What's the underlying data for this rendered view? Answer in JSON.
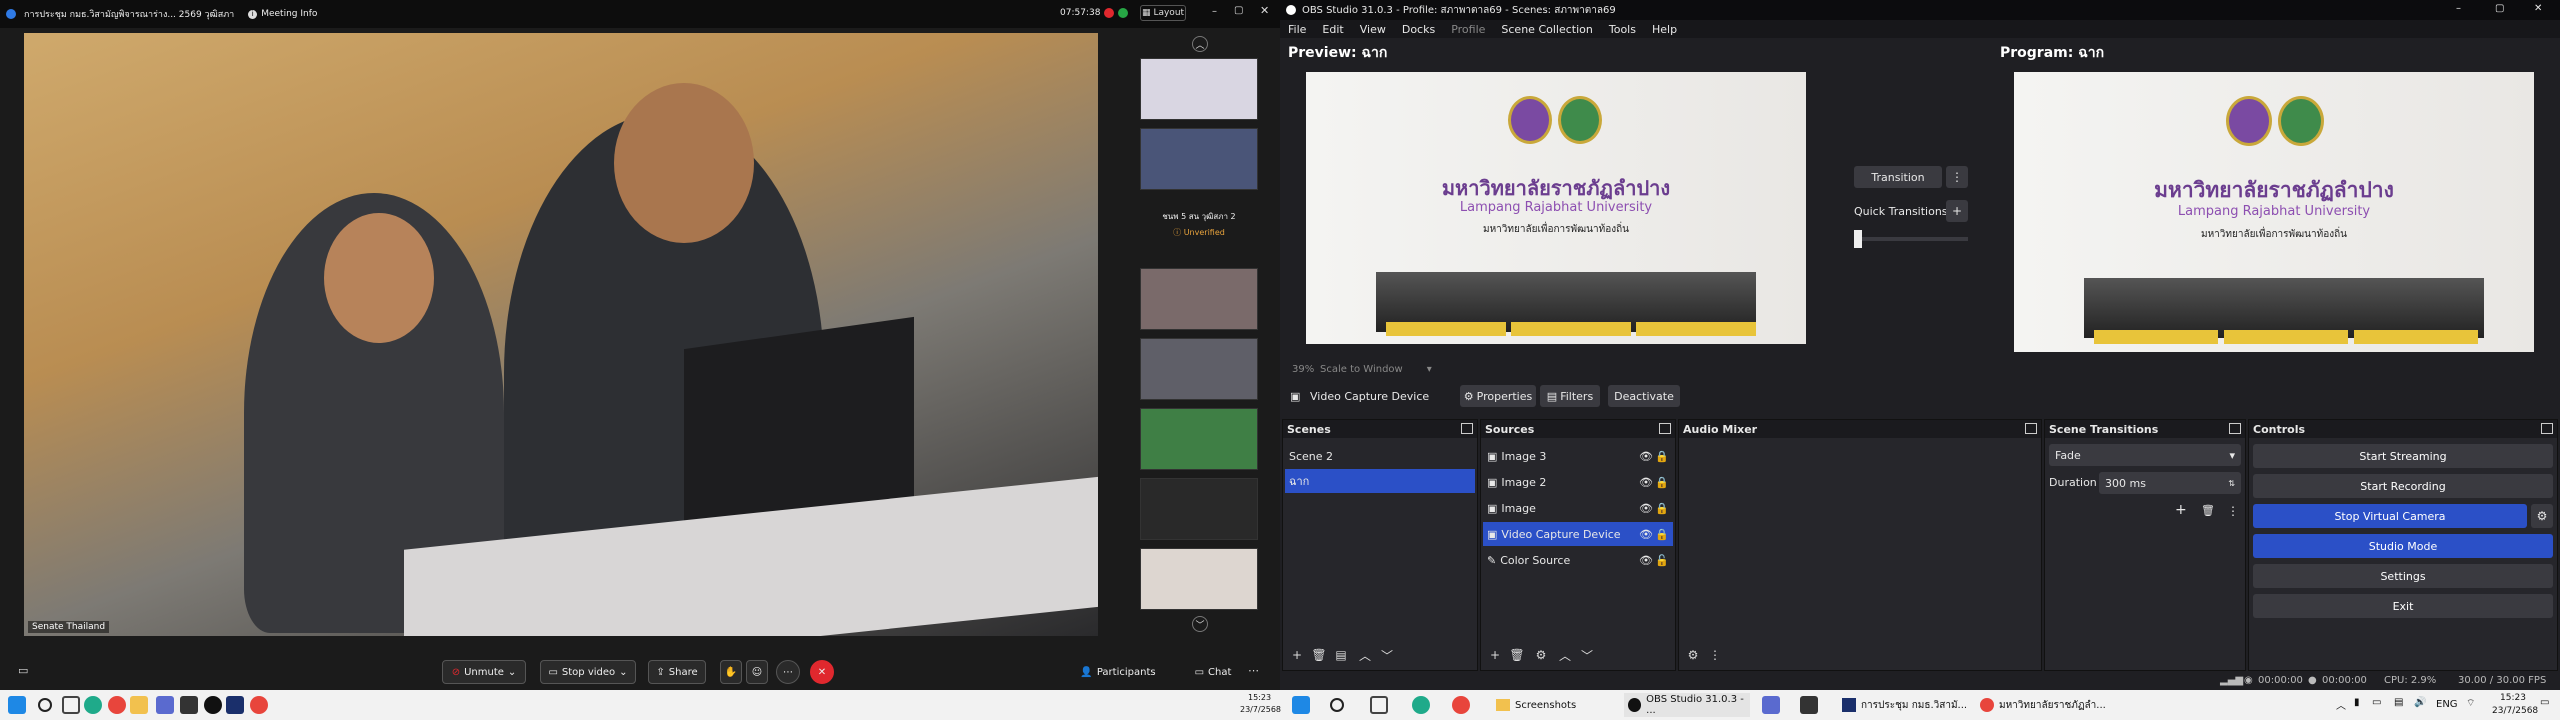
{
  "meeting": {
    "title": "การประชุม กมธ.วิสามัญพิจารณาร่าง... 2569 วุฒิสภา",
    "meeting_info": "Meeting Info",
    "time": "07:57:38",
    "layout": "Layout",
    "participant_name": "Senate Thailand",
    "thumb_label": "ชนพ 5 สน วุฒิสภา 2",
    "thumb_status": "Unverified",
    "toolbar": {
      "unmute": "Unmute",
      "stop_video": "Stop video",
      "share": "Share",
      "participants": "Participants",
      "chat": "Chat"
    }
  },
  "obs": {
    "window_title": "OBS Studio 31.0.3 - Profile: สภาพาตาล69 - Scenes: สภาพาตาล69",
    "menu": [
      "File",
      "Edit",
      "View",
      "Docks",
      "Profile",
      "Scene Collection",
      "Tools",
      "Help"
    ],
    "preview_label": "Preview: ฉาก",
    "program_label": "Program: ฉาก",
    "banner": {
      "thai": "มหาวิทยาลัยราชภัฏลำปาง",
      "english": "Lampang Rajabhat University",
      "slogan": "มหาวิทยาลัยเพื่อการพัฒนาท้องถิ่น"
    },
    "transition": "Transition",
    "quick_transitions": "Quick Transitions",
    "zoom": "39%",
    "scale": "Scale to Window",
    "source_toolbar": {
      "source": "Video Capture Device",
      "properties": "Properties",
      "filters": "Filters",
      "deactivate": "Deactivate"
    },
    "scenes": {
      "title": "Scenes",
      "items": [
        "Scene 2",
        "ฉาก"
      ],
      "selected": 1
    },
    "sources": {
      "title": "Sources",
      "items": [
        "Image 3",
        "Image 2",
        "Image",
        "Video Capture Device",
        "Color Source"
      ],
      "selected": 3
    },
    "audio_mixer": {
      "title": "Audio Mixer"
    },
    "scene_transitions": {
      "title": "Scene Transitions",
      "type": "Fade",
      "duration_label": "Duration",
      "duration": "300 ms"
    },
    "controls": {
      "title": "Controls",
      "start_streaming": "Start Streaming",
      "start_recording": "Start Recording",
      "stop_virtual_camera": "Stop Virtual Camera",
      "studio_mode": "Studio Mode",
      "settings": "Settings",
      "exit": "Exit"
    },
    "status": {
      "stream_time": "00:00:00",
      "rec_time": "00:00:00",
      "cpu": "CPU: 2.9%",
      "fps": "30.00 / 30.00 FPS"
    }
  },
  "taskbar": {
    "apps": [
      "Screenshots",
      "OBS Studio 31.0.3 - ...",
      "การประชุม กมธ.วิสามั...",
      "มหาวิทยาลัยราชภัฏลำ..."
    ],
    "lang": "ENG",
    "time": "15:23",
    "date": "23/7/2568",
    "left_time": "15:23",
    "left_date": "23/7/2568"
  },
  "colors": {
    "obs_accent": "#2b50c7",
    "leave_red": "#e0282e",
    "unmute_red": "#e0282e"
  }
}
